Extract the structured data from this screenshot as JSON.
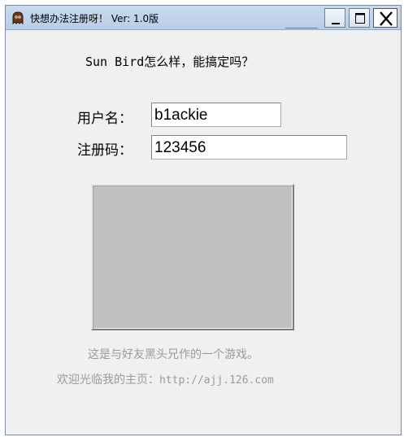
{
  "window": {
    "title": "快想办法注册呀！  Ver: 1.0版",
    "app_icon": "ghost-icon",
    "controls": {
      "minimize_icon": "minimize-icon",
      "maximize_icon": "maximize-icon",
      "close_icon": "close-icon"
    }
  },
  "main": {
    "question": "Sun Bird怎么样，能搞定吗？",
    "username_label": "用户名：",
    "username_value": "b1ackie",
    "regcode_label": "注册码：",
    "regcode_value": "123456",
    "footer_line1": "这是与好友黑头兄作的一个游戏。",
    "footer_line2_prefix": "欢迎光临我的主页：",
    "footer_line2_link": "http://ajj.126.com"
  },
  "colors": {
    "window_bg": "#f0f0f0",
    "titlebar": "#c9daee",
    "image_placeholder": "#c0c0c0",
    "footer_text": "#9a9a9a"
  }
}
